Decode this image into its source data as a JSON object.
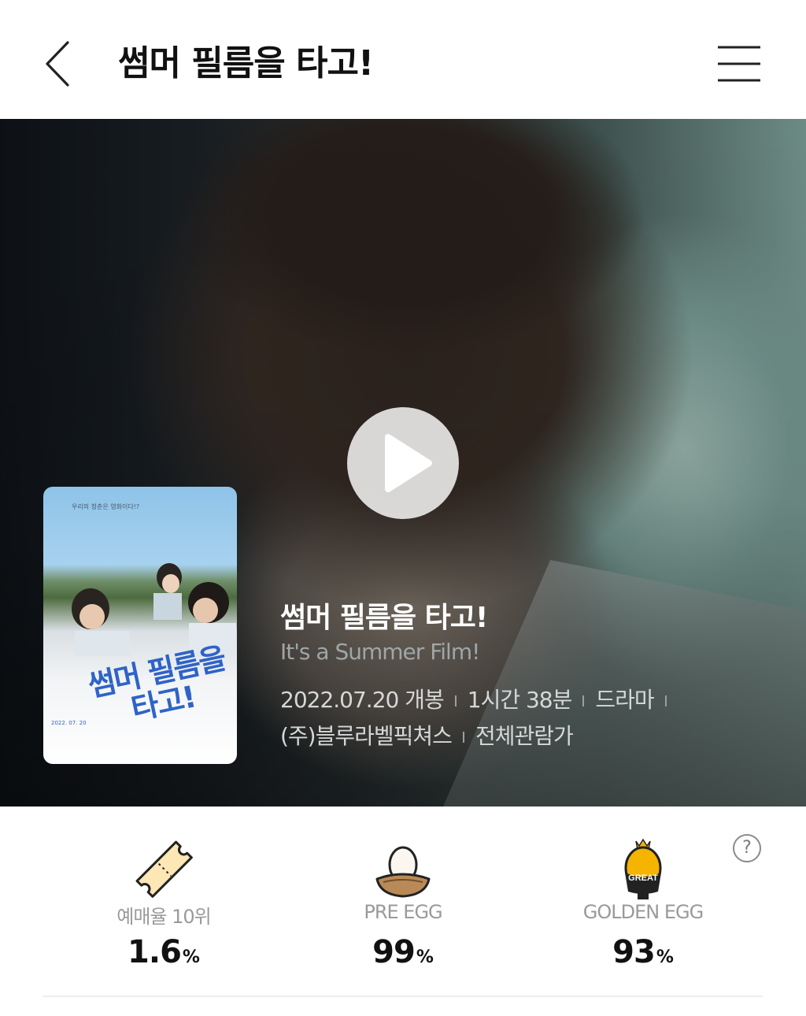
{
  "header": {
    "title": "썸머 필름을 타고!",
    "back_icon": "chevron-left-icon",
    "menu_icon": "hamburger-menu-icon"
  },
  "hero": {
    "play_icon": "play-icon",
    "poster": {
      "tagline": "우리의 청춘은 영화이다!?",
      "title": "썸머 필름을 타고!",
      "date": "2022. 07. 20"
    },
    "movie_title": "썸머 필름을 타고!",
    "movie_subtitle": "It's a Summer Film!",
    "release": "2022.07.20 개봉",
    "runtime": "1시간 38분",
    "genre": "드라마",
    "distributor": "(주)블루라벨픽쳐스",
    "rating": "전체관람가"
  },
  "stats": {
    "reservation": {
      "label": "예매율 10위",
      "value": "1.6",
      "unit": "%",
      "icon": "ticket-icon"
    },
    "pre_egg": {
      "label": "PRE EGG",
      "value": "99",
      "unit": "%",
      "icon": "egg-nest-icon"
    },
    "golden_egg": {
      "label": "GOLDEN EGG",
      "value": "93",
      "unit": "%",
      "icon": "golden-egg-icon",
      "badge": "GREAT"
    },
    "help_label": "?"
  },
  "colors": {
    "accent_blue": "#2f63c6",
    "gold": "#f5b400",
    "text_dark": "#111111",
    "label_gray": "#9a9a9a"
  }
}
